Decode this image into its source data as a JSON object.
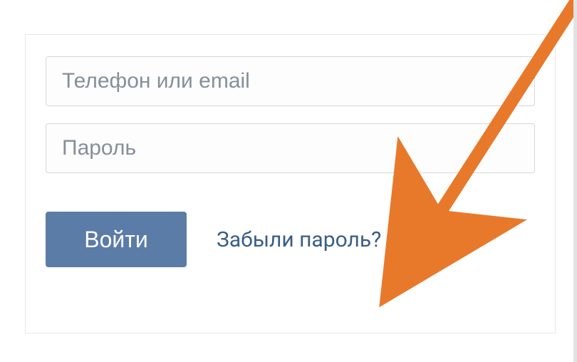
{
  "login": {
    "login_placeholder": "Телефон или email",
    "password_placeholder": "Пароль",
    "submit_label": "Войти",
    "forgot_label": "Забыли пароль?"
  },
  "colors": {
    "button_bg": "#5b7ca7",
    "link_color": "#3a5e84",
    "arrow_color": "#e8792b"
  }
}
